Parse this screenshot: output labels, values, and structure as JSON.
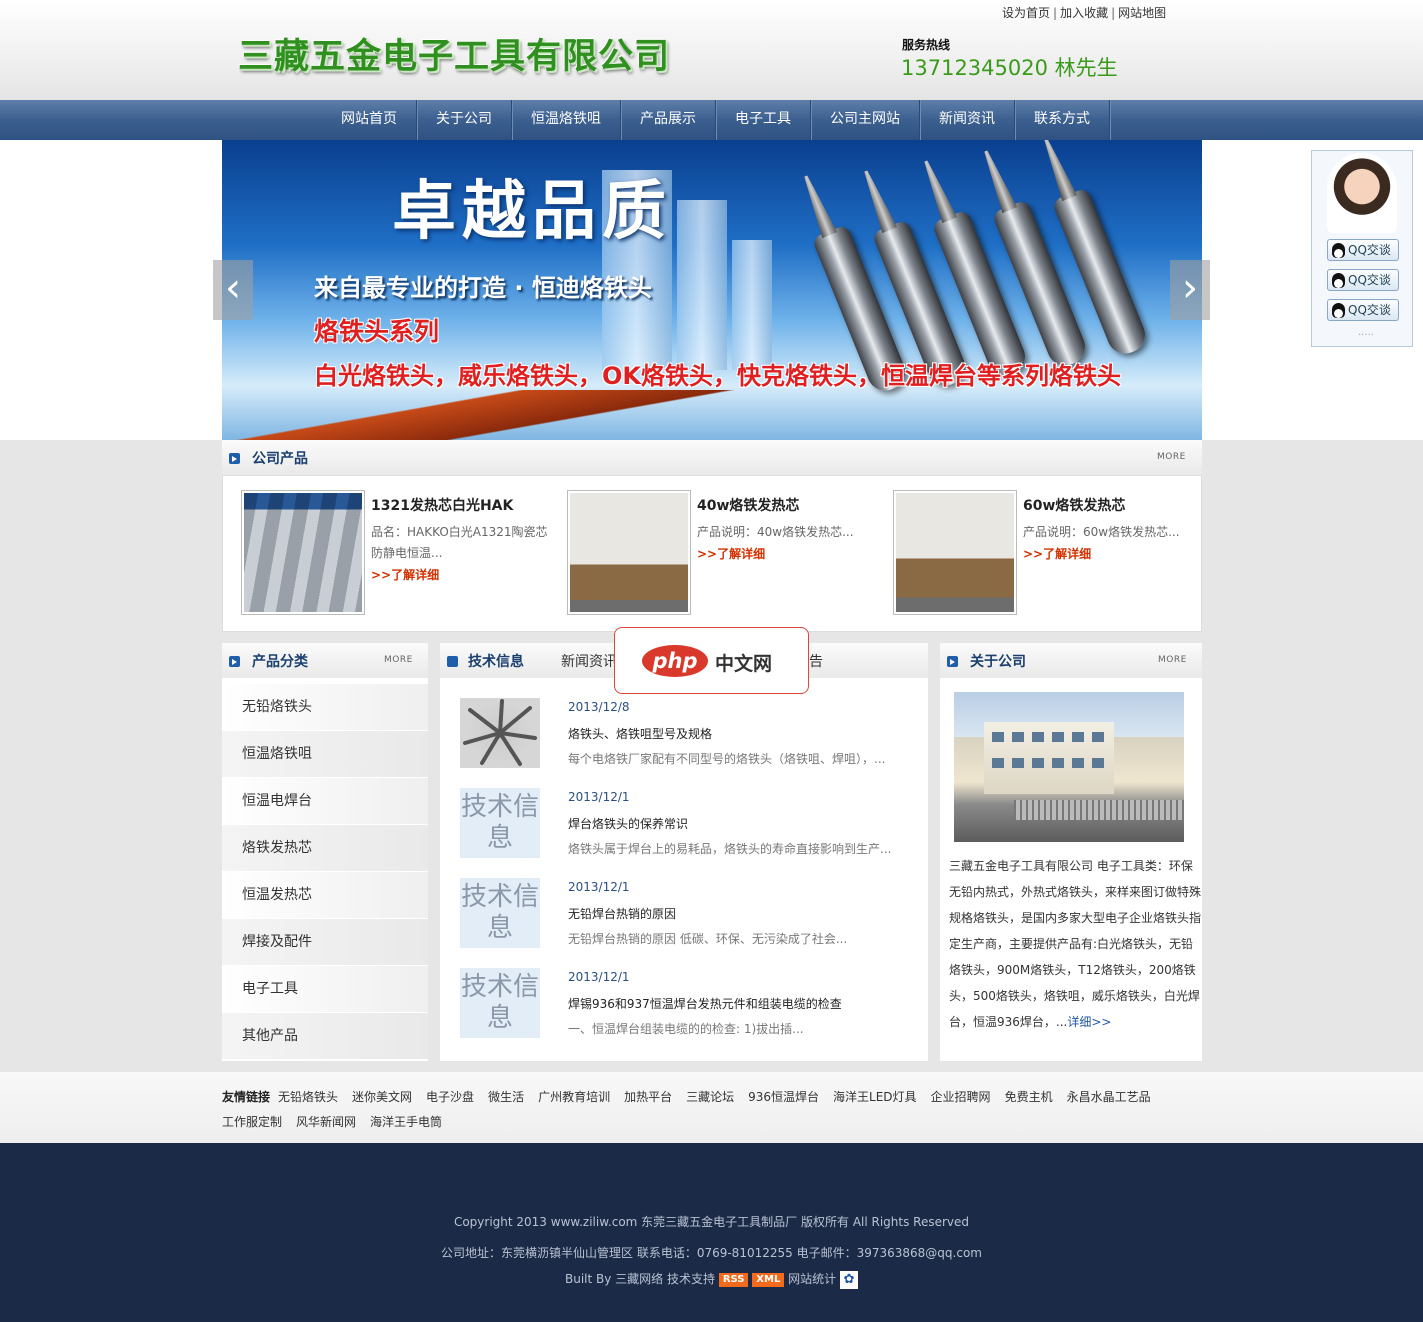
{
  "header": {
    "top_links": [
      "设为首页",
      "加入收藏",
      "网站地图"
    ],
    "logo_text": "三藏五金电子工具有限公司",
    "hotline_label": "服务热线",
    "hotline_number": "13712345020 林先生"
  },
  "nav": {
    "items": [
      "网站首页",
      "关于公司",
      "恒温烙铁咀",
      "产品展示",
      "电子工具",
      "公司主网站",
      "新闻资讯",
      "联系方式"
    ]
  },
  "banner": {
    "title": "卓越品质",
    "subtitle": "来自最专业的打造 · 恒迪烙铁头",
    "series": "烙铁头系列",
    "list": "白光烙铁头，威乐烙铁头，OK烙铁头，快克烙铁头，恒温焊台等系列烙铁头",
    "prev_icon": "chevron-left-icon",
    "next_icon": "chevron-right-icon"
  },
  "qq_panel": {
    "buttons": [
      "QQ交谈",
      "QQ交谈",
      "QQ交谈"
    ],
    "dots": "....."
  },
  "company_products": {
    "title": "公司产品",
    "more": "MORE",
    "items": [
      {
        "name": "1321发热芯白光HAK",
        "desc": "品名：HAKKO白光A1321陶瓷芯防静电恒温...",
        "link": ">>了解详细"
      },
      {
        "name": "40w烙铁发热芯",
        "desc": "产品说明：40w烙铁发热芯...",
        "link": ">>了解详细"
      },
      {
        "name": "60w烙铁发热芯",
        "desc": "产品说明：60w烙铁发热芯...",
        "link": ">>了解详细"
      }
    ]
  },
  "categories": {
    "title": "产品分类",
    "more": "MORE",
    "items": [
      "无铅烙铁头",
      "恒温烙铁咀",
      "恒温电焊台",
      "烙铁发热芯",
      "恒温发热芯",
      "焊接及配件",
      "电子工具",
      "其他产品"
    ]
  },
  "tech": {
    "tabs": [
      "技术信息",
      "新闻资讯",
      "公告"
    ],
    "placeholder_text": "技术信息",
    "items": [
      {
        "date": "2013/12/8",
        "title": "烙铁头、烙铁咀型号及规格",
        "desc": "每个电烙铁厂家配有不同型号的烙铁头（烙铁咀、焊咀），..."
      },
      {
        "date": "2013/12/1",
        "title": "焊台烙铁头的保养常识",
        "desc": "烙铁头属于焊台上的易耗品，烙铁头的寿命直接影响到生产..."
      },
      {
        "date": "2013/12/1",
        "title": "无铅焊台热销的原因",
        "desc": "无铅焊台热销的原因 低碳、环保、无污染成了社会..."
      },
      {
        "date": "2013/12/1",
        "title": "焊锡936和937恒温焊台发热元件和组装电缆的检查",
        "desc": "一、恒温焊台组装电缆的的检查: 1)拔出插..."
      }
    ]
  },
  "about": {
    "title": "关于公司",
    "more": "MORE",
    "text": "三藏五金电子工具有限公司 电子工具类：环保无铅内热式，外热式烙铁头，来样来图订做特殊规格烙铁头，是国内多家大型电子企业烙铁头指定生产商，主要提供产品有:白光烙铁头，无铅烙铁头，900M烙铁头，T12烙铁头，200烙铁头，500烙铁头，烙铁咀，威乐烙铁头，白光焊台，恒温936焊台，...",
    "more_link": "详细>>"
  },
  "friend_links": {
    "label": "友情链接",
    "items": [
      "无铅烙铁头",
      "迷你美文网",
      "电子沙盘",
      "微生活",
      "广州教育培训",
      "加热平台",
      "三藏论坛",
      "936恒温焊台",
      "海洋王LED灯具",
      "企业招聘网",
      "免费主机",
      "永昌水晶工艺品",
      "工作服定制",
      "风华新闻网",
      "海洋王手电筒"
    ]
  },
  "footer": {
    "copyright": "Copyright 2013 www.ziliw.com 东莞三藏五金电子工具制品厂 版权所有 All Rights Reserved",
    "address": "公司地址：东莞横沥镇半仙山管理区 联系电话：0769-81012255 电子邮件：397363868@qq.com",
    "built_by": "Built By 三藏网络 技术支持",
    "rss": "RSS",
    "xml": "XML",
    "stats": "网站统计"
  },
  "watermark": {
    "php": "php",
    "cn": "中文网"
  }
}
